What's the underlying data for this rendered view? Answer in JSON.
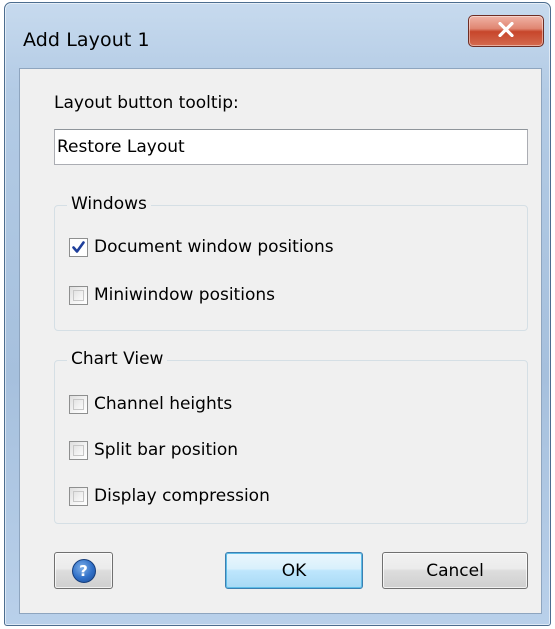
{
  "window": {
    "title": "Add Layout 1",
    "close_icon": "close-icon"
  },
  "tooltip_field": {
    "label": "Layout button tooltip:",
    "value": "Restore Layout"
  },
  "windows_group": {
    "title": "Windows",
    "options": [
      {
        "label": "Document window positions",
        "checked": true
      },
      {
        "label": "Miniwindow positions",
        "checked": false
      }
    ]
  },
  "chart_view_group": {
    "title": "Chart View",
    "options": [
      {
        "label": "Channel heights",
        "checked": false
      },
      {
        "label": "Split bar position",
        "checked": false
      },
      {
        "label": "Display compression",
        "checked": false
      }
    ]
  },
  "buttons": {
    "help_icon": "help-icon",
    "help_glyph": "?",
    "ok_label": "OK",
    "cancel_label": "Cancel"
  },
  "colors": {
    "frame": "#b3cbe5",
    "close_button": "#c7462b",
    "default_button": "#bee6fd",
    "check_mark": "#1f3f9b"
  }
}
